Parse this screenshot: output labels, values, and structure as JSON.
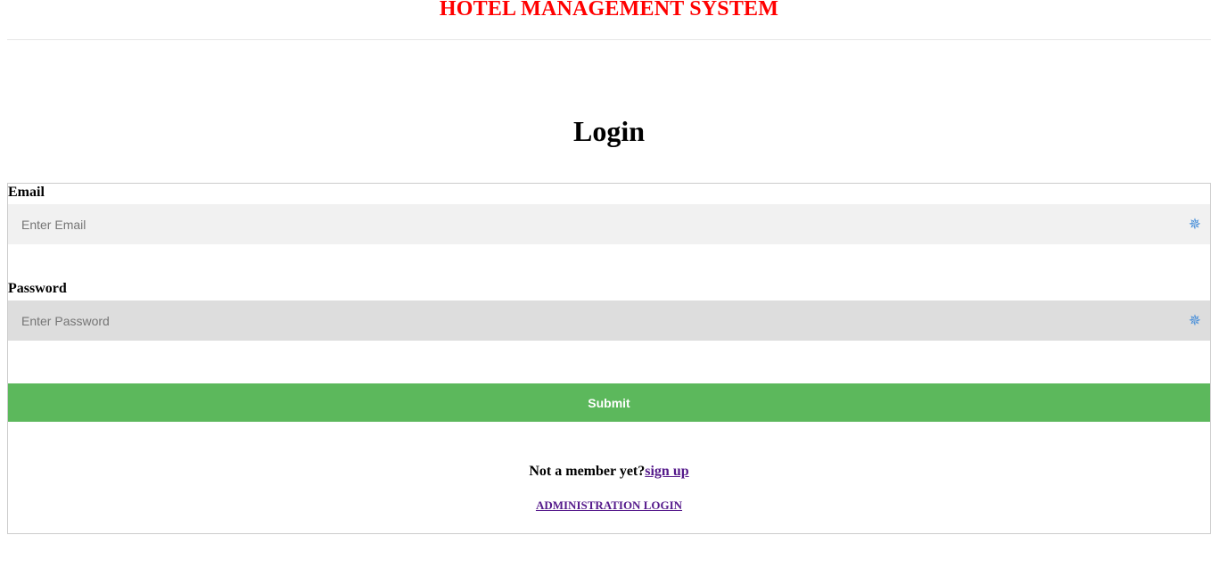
{
  "header": {
    "title": "HOTEL MANAGEMENT SYSTEM"
  },
  "login": {
    "heading": "Login",
    "email": {
      "label": "Email",
      "placeholder": "Enter Email",
      "value": "",
      "icon": "password-manager-icon"
    },
    "password": {
      "label": "Password",
      "placeholder": "Enter Password",
      "value": "",
      "icon": "password-manager-icon"
    },
    "submit_label": "Submit",
    "signup_prompt": "Not a member yet?",
    "signup_link": "sign up",
    "admin_link": "ADMINISTRATION LOGIN"
  },
  "colors": {
    "title": "#ff0000",
    "submit_bg": "#5cb85c",
    "link": "#551a8b",
    "email_bg": "#f1f1f1",
    "password_bg": "#dddddd"
  }
}
